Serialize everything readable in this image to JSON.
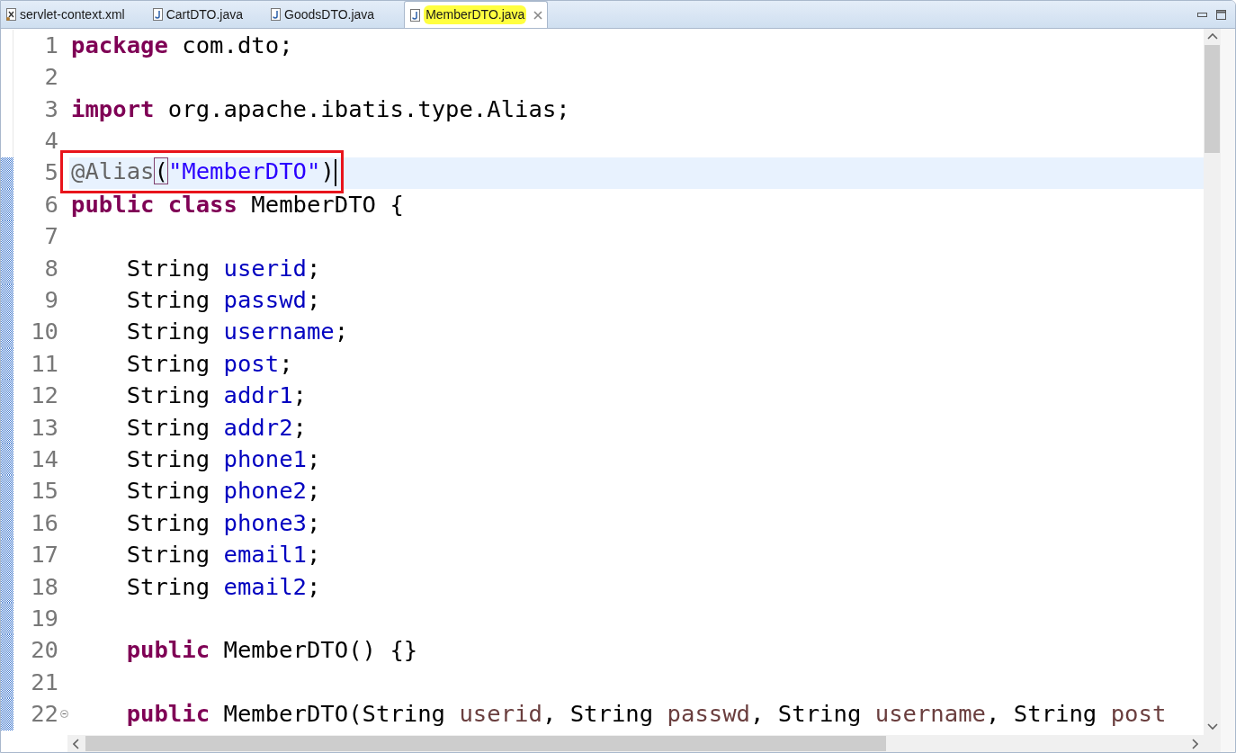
{
  "tabs": [
    {
      "label": "servlet-context.xml",
      "kind": "xml",
      "selected": false,
      "highlighted": false
    },
    {
      "label": "CartDTO.java",
      "kind": "java",
      "selected": false,
      "highlighted": false
    },
    {
      "label": "GoodsDTO.java",
      "kind": "java",
      "selected": false,
      "highlighted": false
    },
    {
      "label": "MemberDTO.java",
      "kind": "java",
      "selected": true,
      "highlighted": true
    }
  ],
  "editor": {
    "lines": [
      {
        "number": "1",
        "indent": false,
        "current": false,
        "changed": false,
        "foldable": false,
        "boxed": false,
        "caret": false,
        "tokens": [
          {
            "kind": "keyword",
            "text": "package"
          },
          {
            "kind": "plain",
            "text": " com.dto;"
          }
        ]
      },
      {
        "number": "2",
        "indent": false,
        "current": false,
        "changed": false,
        "foldable": false,
        "boxed": false,
        "caret": false
      },
      {
        "number": "3",
        "indent": false,
        "current": false,
        "changed": false,
        "foldable": false,
        "boxed": false,
        "caret": false,
        "tokens": [
          {
            "kind": "keyword",
            "text": "import"
          },
          {
            "kind": "plain",
            "text": " org.apache.ibatis.type.Alias;"
          }
        ]
      },
      {
        "number": "4",
        "indent": false,
        "current": false,
        "changed": false,
        "foldable": false,
        "boxed": false,
        "caret": false
      },
      {
        "number": "5",
        "indent": false,
        "current": true,
        "changed": true,
        "foldable": false,
        "boxed": true,
        "caret": true,
        "tokens": [
          {
            "kind": "annotation",
            "text": "@Alias"
          },
          {
            "kind": "bracket_match",
            "text": "("
          },
          {
            "kind": "string",
            "text": "\"MemberDTO\""
          },
          {
            "kind": "plain",
            "text": ")"
          }
        ]
      },
      {
        "number": "6",
        "indent": false,
        "current": false,
        "changed": true,
        "foldable": false,
        "boxed": false,
        "caret": false,
        "tokens": [
          {
            "kind": "keyword",
            "text": "public class"
          },
          {
            "kind": "plain",
            "text": " MemberDTO {"
          }
        ]
      },
      {
        "number": "7",
        "indent": false,
        "current": false,
        "changed": true,
        "foldable": false,
        "boxed": false,
        "caret": false
      },
      {
        "number": "8",
        "indent": true,
        "current": false,
        "changed": true,
        "foldable": false,
        "boxed": false,
        "caret": false,
        "tokens": [
          {
            "kind": "plain",
            "text": "String "
          },
          {
            "kind": "field",
            "text": "userid"
          },
          {
            "kind": "plain",
            "text": ";"
          }
        ]
      },
      {
        "number": "9",
        "indent": true,
        "current": false,
        "changed": true,
        "foldable": false,
        "boxed": false,
        "caret": false,
        "tokens": [
          {
            "kind": "plain",
            "text": "String "
          },
          {
            "kind": "field",
            "text": "passwd"
          },
          {
            "kind": "plain",
            "text": ";"
          }
        ]
      },
      {
        "number": "10",
        "indent": true,
        "current": false,
        "changed": true,
        "foldable": false,
        "boxed": false,
        "caret": false,
        "tokens": [
          {
            "kind": "plain",
            "text": "String "
          },
          {
            "kind": "field",
            "text": "username"
          },
          {
            "kind": "plain",
            "text": ";"
          }
        ]
      },
      {
        "number": "11",
        "indent": true,
        "current": false,
        "changed": true,
        "foldable": false,
        "boxed": false,
        "caret": false,
        "tokens": [
          {
            "kind": "plain",
            "text": "String "
          },
          {
            "kind": "field",
            "text": "post"
          },
          {
            "kind": "plain",
            "text": ";"
          }
        ]
      },
      {
        "number": "12",
        "indent": true,
        "current": false,
        "changed": true,
        "foldable": false,
        "boxed": false,
        "caret": false,
        "tokens": [
          {
            "kind": "plain",
            "text": "String "
          },
          {
            "kind": "field",
            "text": "addr1"
          },
          {
            "kind": "plain",
            "text": ";"
          }
        ]
      },
      {
        "number": "13",
        "indent": true,
        "current": false,
        "changed": true,
        "foldable": false,
        "boxed": false,
        "caret": false,
        "tokens": [
          {
            "kind": "plain",
            "text": "String "
          },
          {
            "kind": "field",
            "text": "addr2"
          },
          {
            "kind": "plain",
            "text": ";"
          }
        ]
      },
      {
        "number": "14",
        "indent": true,
        "current": false,
        "changed": true,
        "foldable": false,
        "boxed": false,
        "caret": false,
        "tokens": [
          {
            "kind": "plain",
            "text": "String "
          },
          {
            "kind": "field",
            "text": "phone1"
          },
          {
            "kind": "plain",
            "text": ";"
          }
        ]
      },
      {
        "number": "15",
        "indent": true,
        "current": false,
        "changed": true,
        "foldable": false,
        "boxed": false,
        "caret": false,
        "tokens": [
          {
            "kind": "plain",
            "text": "String "
          },
          {
            "kind": "field",
            "text": "phone2"
          },
          {
            "kind": "plain",
            "text": ";"
          }
        ]
      },
      {
        "number": "16",
        "indent": true,
        "current": false,
        "changed": true,
        "foldable": false,
        "boxed": false,
        "caret": false,
        "tokens": [
          {
            "kind": "plain",
            "text": "String "
          },
          {
            "kind": "field",
            "text": "phone3"
          },
          {
            "kind": "plain",
            "text": ";"
          }
        ]
      },
      {
        "number": "17",
        "indent": true,
        "current": false,
        "changed": true,
        "foldable": false,
        "boxed": false,
        "caret": false,
        "tokens": [
          {
            "kind": "plain",
            "text": "String "
          },
          {
            "kind": "field",
            "text": "email1"
          },
          {
            "kind": "plain",
            "text": ";"
          }
        ]
      },
      {
        "number": "18",
        "indent": true,
        "current": false,
        "changed": true,
        "foldable": false,
        "boxed": false,
        "caret": false,
        "tokens": [
          {
            "kind": "plain",
            "text": "String "
          },
          {
            "kind": "field",
            "text": "email2"
          },
          {
            "kind": "plain",
            "text": ";"
          }
        ]
      },
      {
        "number": "19",
        "indent": false,
        "current": false,
        "changed": true,
        "foldable": false,
        "boxed": false,
        "caret": false
      },
      {
        "number": "20",
        "indent": true,
        "current": false,
        "changed": true,
        "foldable": false,
        "boxed": false,
        "caret": false,
        "tokens": [
          {
            "kind": "keyword",
            "text": "public"
          },
          {
            "kind": "plain",
            "text": " MemberDTO() {}"
          }
        ]
      },
      {
        "number": "21",
        "indent": false,
        "current": false,
        "changed": true,
        "foldable": false,
        "boxed": false,
        "caret": false
      },
      {
        "number": "22",
        "indent": true,
        "current": false,
        "changed": true,
        "foldable": true,
        "boxed": false,
        "caret": false,
        "tokens": [
          {
            "kind": "keyword",
            "text": "public"
          },
          {
            "kind": "plain",
            "text": " MemberDTO(String "
          },
          {
            "kind": "param",
            "text": "userid"
          },
          {
            "kind": "plain",
            "text": ", String "
          },
          {
            "kind": "param",
            "text": "passwd"
          },
          {
            "kind": "plain",
            "text": ", String "
          },
          {
            "kind": "param",
            "text": "username"
          },
          {
            "kind": "plain",
            "text": ", String "
          },
          {
            "kind": "param",
            "text": "post"
          }
        ]
      }
    ]
  }
}
